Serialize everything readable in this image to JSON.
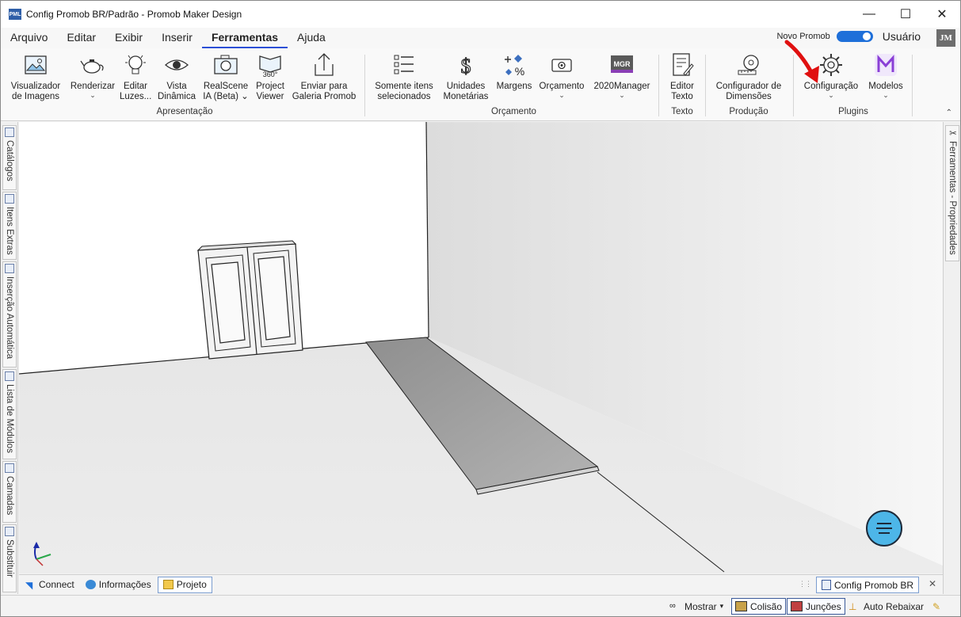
{
  "window": {
    "title": "Config Promob BR/Padrão - Promob Maker Design",
    "logo_text": "PML",
    "controls": [
      "—",
      "☐",
      "✕"
    ]
  },
  "menu": {
    "items": [
      "Arquivo",
      "Editar",
      "Exibir",
      "Inserir",
      "Ferramentas",
      "Ajuda"
    ],
    "active": "Ferramentas",
    "toggle_label": "Novo Promob",
    "toggle_on": true,
    "user_label": "Usuário",
    "avatar_initials": "JM"
  },
  "ribbon": {
    "buttons": [
      {
        "line1": "Visualizador",
        "line2": "de Imagens",
        "icon": "image-viewer-icon",
        "dropdown": false
      },
      {
        "line1": "Renderizar",
        "line2": "",
        "icon": "teapot-render-icon",
        "dropdown": true
      },
      {
        "line1": "Editar",
        "line2": "Luzes...",
        "icon": "lightbulb-icon",
        "dropdown": false
      },
      {
        "line1": "Vista",
        "line2": "Dinâmica",
        "icon": "eye-icon",
        "dropdown": false
      },
      {
        "line1": "RealScene",
        "line2": "IA (Beta) ⌄",
        "icon": "camera-icon",
        "dropdown": false
      },
      {
        "line1": "Project",
        "line2": "Viewer",
        "icon": "viewer-360-icon",
        "dropdown": false
      },
      {
        "line1": "Enviar para",
        "line2": "Galeria Promob",
        "icon": "upload-icon",
        "dropdown": false
      },
      {
        "line1": "Somente itens",
        "line2": "selecionados",
        "icon": "checklist-icon",
        "dropdown": false
      },
      {
        "line1": "Unidades",
        "line2": "Monetárias",
        "icon": "dollar-icon",
        "dropdown": false
      },
      {
        "line1": "Margens",
        "line2": "",
        "icon": "percent-icon",
        "dropdown": false
      },
      {
        "line1": "Orçamento",
        "line2": "",
        "icon": "budget-icon",
        "dropdown": true
      },
      {
        "line1": "2020Manager",
        "line2": "",
        "icon": "manager-icon",
        "dropdown": true
      },
      {
        "line1": "Editor",
        "line2": "Texto",
        "icon": "text-editor-icon",
        "dropdown": false
      },
      {
        "line1": "Configurador de",
        "line2": "Dimensões",
        "icon": "tape-measure-icon",
        "dropdown": false
      },
      {
        "line1": "Configuração",
        "line2": "",
        "icon": "gear-icon",
        "dropdown": true
      },
      {
        "line1": "Modelos",
        "line2": "",
        "icon": "models-icon",
        "dropdown": true
      }
    ],
    "groups": [
      "Apresentação",
      "Orçamento",
      "Texto",
      "Produção",
      "Plugins"
    ],
    "manager_badge": "MGR",
    "viewer_badge": "360°"
  },
  "left_tabs": [
    "Catálogos",
    "Itens Extras",
    "Inserção Automática",
    "Lista de Módulos",
    "Camadas",
    "Substituir"
  ],
  "right_tabs": [
    "Ferramentas - Propriedades"
  ],
  "bottom_tabs": [
    {
      "label": "Connect",
      "selected": false
    },
    {
      "label": "Informações",
      "selected": false
    },
    {
      "label": "Projeto",
      "selected": true
    }
  ],
  "document_tab": "Config Promob BR",
  "status": {
    "mostrar": "Mostrar",
    "colisao": "Colisão",
    "juncoes": "Junções",
    "auto_rebaixar": "Auto Rebaixar"
  },
  "colors": {
    "accent": "#2b4fd6",
    "toggle": "#1e6fd9",
    "fab": "#4db6e8",
    "arrow": "#e01010"
  }
}
